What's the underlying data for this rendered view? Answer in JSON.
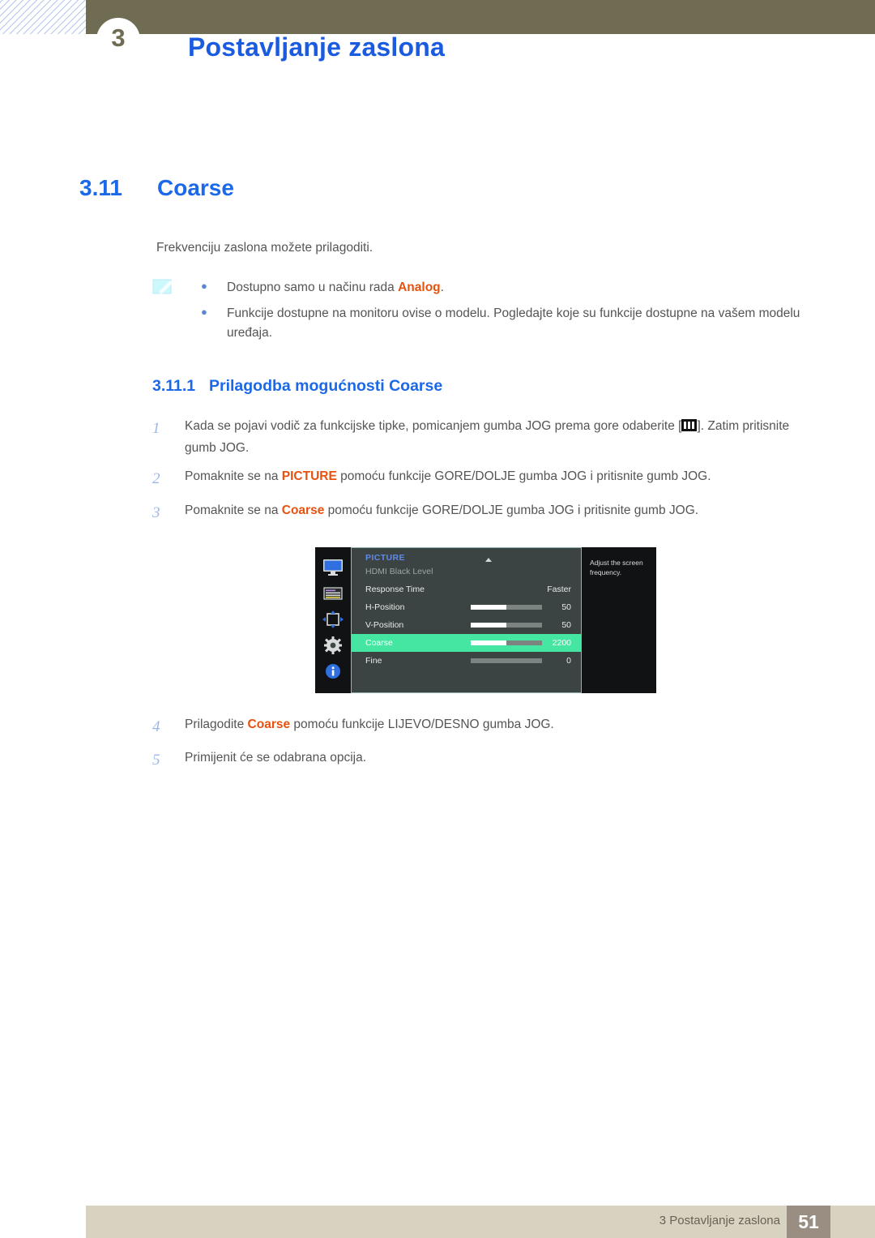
{
  "header": {
    "chapter_number": "3",
    "title": "Postavljanje zaslona"
  },
  "section": {
    "number": "3.11",
    "title": "Coarse"
  },
  "intro": "Frekvenciju zaslona možete prilagoditi.",
  "note": {
    "icon": "note-pencil-icon",
    "bullets": [
      {
        "before": "Dostupno samo u načinu rada ",
        "keyword": "Analog",
        "after": "."
      },
      {
        "before": "Funkcije dostupne na monitoru ovise o modelu. Pogledajte koje su funkcije dostupne na vašem modelu uređaja.",
        "keyword": "",
        "after": ""
      }
    ]
  },
  "subsection": {
    "number": "3.11.1",
    "title": "Prilagodba mogućnosti Coarse"
  },
  "steps_top": [
    {
      "num": "1",
      "before": "Kada se pojavi vodič za funkcijske tipke, pomicanjem gumba JOG prema gore odaberite [",
      "icon": "picture-menu-icon",
      "after": "]. Zatim pritisnite gumb JOG."
    },
    {
      "num": "2",
      "before": "Pomaknite se na ",
      "keyword": "PICTURE",
      "after": " pomoću funkcije GORE/DOLJE gumba JOG i pritisnite gumb JOG."
    },
    {
      "num": "3",
      "before": "Pomaknite se na ",
      "keyword": "Coarse",
      "after": " pomoću funkcije GORE/DOLJE gumba JOG i pritisnite gumb JOG."
    }
  ],
  "steps_bottom": [
    {
      "num": "4",
      "before": "Prilagodite ",
      "keyword": "Coarse",
      "after": " pomoću funkcije LIJEVO/DESNO gumba JOG."
    },
    {
      "num": "5",
      "before": "Primijenit će se odabrana opcija.",
      "keyword": "",
      "after": ""
    }
  ],
  "osd": {
    "title": "PICTURE",
    "rail_icons": [
      "monitor-icon",
      "menu-list-icon",
      "move-arrows-icon",
      "gear-icon",
      "info-icon"
    ],
    "rows": [
      {
        "label": "HDMI Black Level",
        "value": "",
        "slider": null,
        "state": "dim"
      },
      {
        "label": "Response Time",
        "value": "Faster",
        "slider": null,
        "state": "normal"
      },
      {
        "label": "H-Position",
        "value": "50",
        "slider": 50,
        "state": "normal"
      },
      {
        "label": "V-Position",
        "value": "50",
        "slider": 50,
        "state": "normal"
      },
      {
        "label": "Coarse",
        "value": "2200",
        "slider": 50,
        "state": "selected"
      },
      {
        "label": "Fine",
        "value": "0",
        "slider": 0,
        "state": "normal"
      }
    ],
    "help_text": "Adjust the screen frequency.",
    "highlight_color": "#45e6a2",
    "title_color": "#5f8ae8"
  },
  "footer": {
    "text": "3 Postavljanje zaslona",
    "page": "51"
  }
}
